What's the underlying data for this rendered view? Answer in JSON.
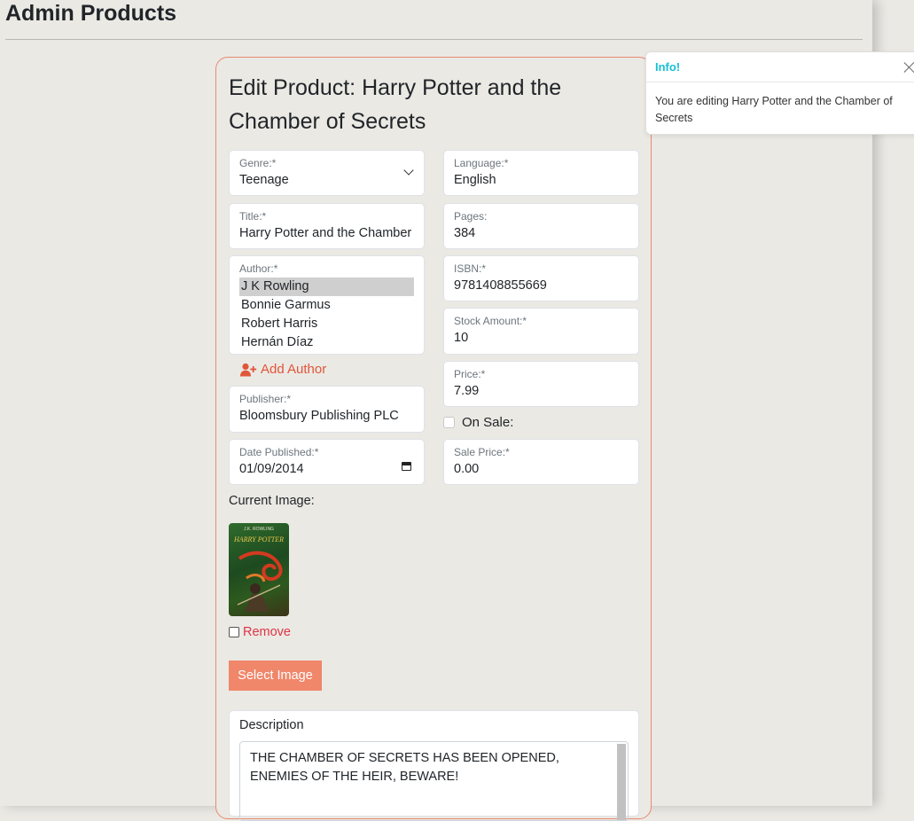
{
  "page": {
    "title": "Admin Products"
  },
  "form": {
    "heading": "Edit Product: Harry Potter and the Chamber of Secrets",
    "genre": {
      "label": "Genre:*",
      "value": "Teenage"
    },
    "language": {
      "label": "Language:*",
      "value": "English"
    },
    "title": {
      "label": "Title:*",
      "value": "Harry Potter and the Chamber of Secrets"
    },
    "pages": {
      "label": "Pages:",
      "value": "384"
    },
    "author": {
      "label": "Author:*",
      "options": [
        "J K Rowling",
        "Bonnie Garmus",
        "Robert Harris",
        "Hernán Díaz"
      ],
      "selected": "J K Rowling"
    },
    "isbn": {
      "label": "ISBN:*",
      "value": "9781408855669"
    },
    "stock": {
      "label": "Stock Amount:*",
      "value": "10"
    },
    "add_author_label": "Add Author",
    "price": {
      "label": "Price:*",
      "value": "7.99"
    },
    "publisher": {
      "label": "Publisher:*",
      "value": "Bloomsbury Publishing PLC"
    },
    "on_sale": {
      "label": "On Sale:",
      "checked": false
    },
    "date_published": {
      "label": "Date Published:*",
      "value": "01/09/2014"
    },
    "sale_price": {
      "label": "Sale Price:*",
      "value": "0.00"
    },
    "current_image_label": "Current Image:",
    "book_cover": {
      "author_text": "J.K. ROWLING",
      "title_text": "HARRY POTTER"
    },
    "remove_label": "Remove",
    "select_image_label": "Select Image",
    "description": {
      "label": "Description",
      "value": "THE CHAMBER OF SECRETS HAS BEEN OPENED, ENEMIES OF THE HEIR, BEWARE!"
    }
  },
  "toast": {
    "title": "Info!",
    "message": "You are editing Harry Potter and the Chamber of Secrets"
  },
  "colors": {
    "accent": "#e0563a",
    "button": "#f0866a",
    "info": "#17c0d6",
    "background": "#ebe9e4"
  },
  "icons": {
    "genre_select": "chevron-down-icon",
    "date": "calendar-icon",
    "add_author": "user-plus-icon",
    "toast_close": "close-icon"
  }
}
